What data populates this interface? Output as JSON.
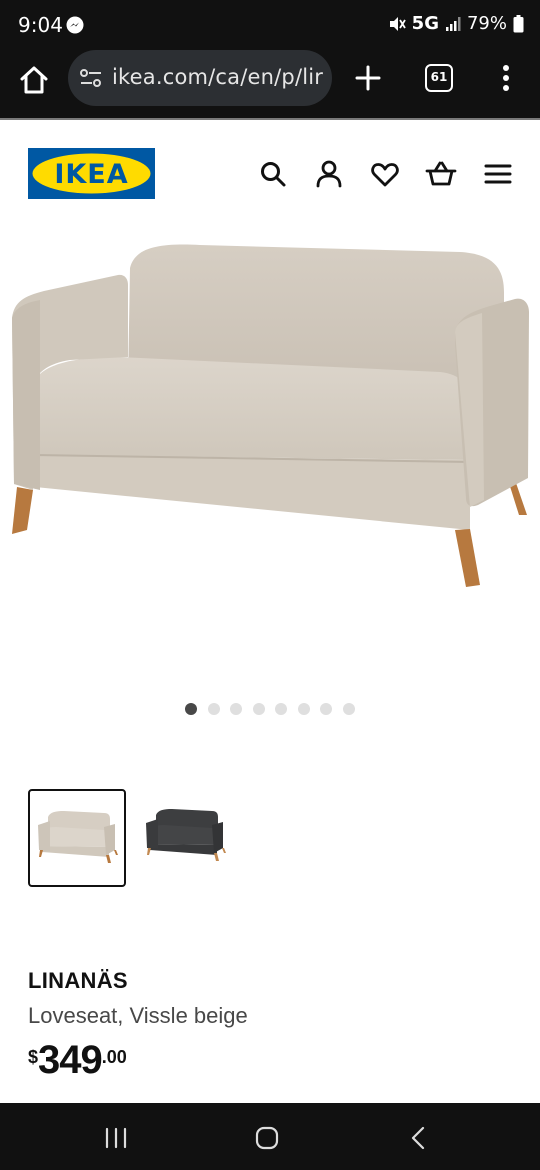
{
  "status_bar": {
    "time": "9:04",
    "network": "5G",
    "battery": "79%",
    "icons": [
      "messenger-icon",
      "mute-icon",
      "signal-icon",
      "battery-icon"
    ]
  },
  "browser": {
    "url": "ikea.com/ca/en/p/lir",
    "tab_count": "61",
    "icons": [
      "home-icon",
      "site-settings-icon",
      "new-tab-icon",
      "tab-switcher-icon",
      "more-icon"
    ]
  },
  "header": {
    "logo_text": "IKEA",
    "brand_colors": {
      "blue": "#0058a3",
      "yellow": "#ffdb00"
    },
    "icons": [
      "search-icon",
      "account-icon",
      "heart-icon",
      "basket-icon",
      "menu-icon"
    ]
  },
  "gallery": {
    "image_count": 8,
    "active_index": 0,
    "thumbnails": [
      {
        "color": "beige",
        "selected": true
      },
      {
        "color": "dark grey",
        "selected": false
      }
    ]
  },
  "product": {
    "name": "LINANÄS",
    "description": "Loveseat, Vissle beige",
    "price": {
      "currency": "$",
      "integer": "349",
      "decimals": ".00"
    }
  },
  "nav_bar": {
    "icons": [
      "recent-apps-icon",
      "home-nav-icon",
      "back-icon"
    ]
  }
}
